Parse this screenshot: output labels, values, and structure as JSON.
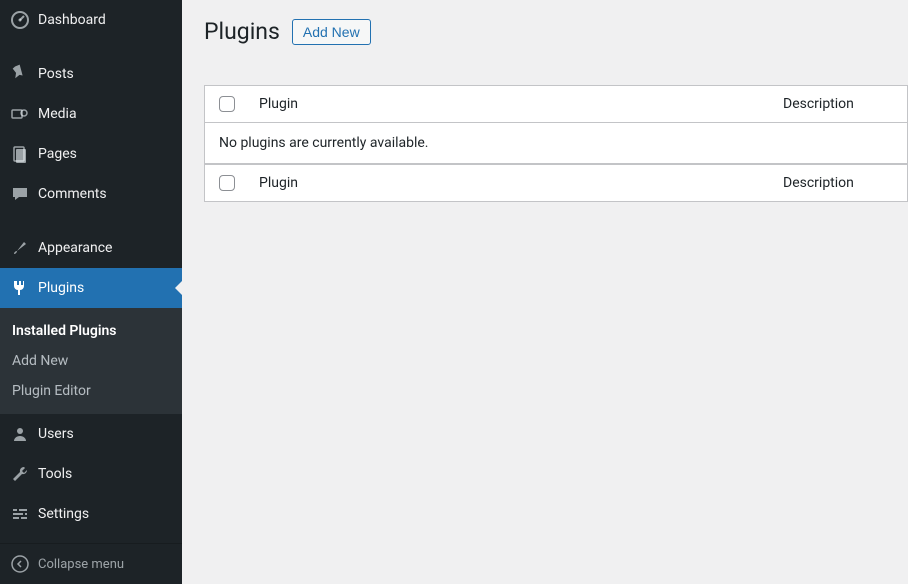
{
  "sidebar": {
    "dashboard": "Dashboard",
    "posts": "Posts",
    "media": "Media",
    "pages": "Pages",
    "comments": "Comments",
    "appearance": "Appearance",
    "plugins": "Plugins",
    "submenu": {
      "installed": "Installed Plugins",
      "addnew": "Add New",
      "editor": "Plugin Editor"
    },
    "users": "Users",
    "tools": "Tools",
    "settings": "Settings",
    "collapse": "Collapse menu"
  },
  "page": {
    "title": "Plugins",
    "add_new": "Add New"
  },
  "table": {
    "header_plugin": "Plugin",
    "header_description": "Description",
    "footer_plugin": "Plugin",
    "footer_description": "Description",
    "empty": "No plugins are currently available."
  }
}
